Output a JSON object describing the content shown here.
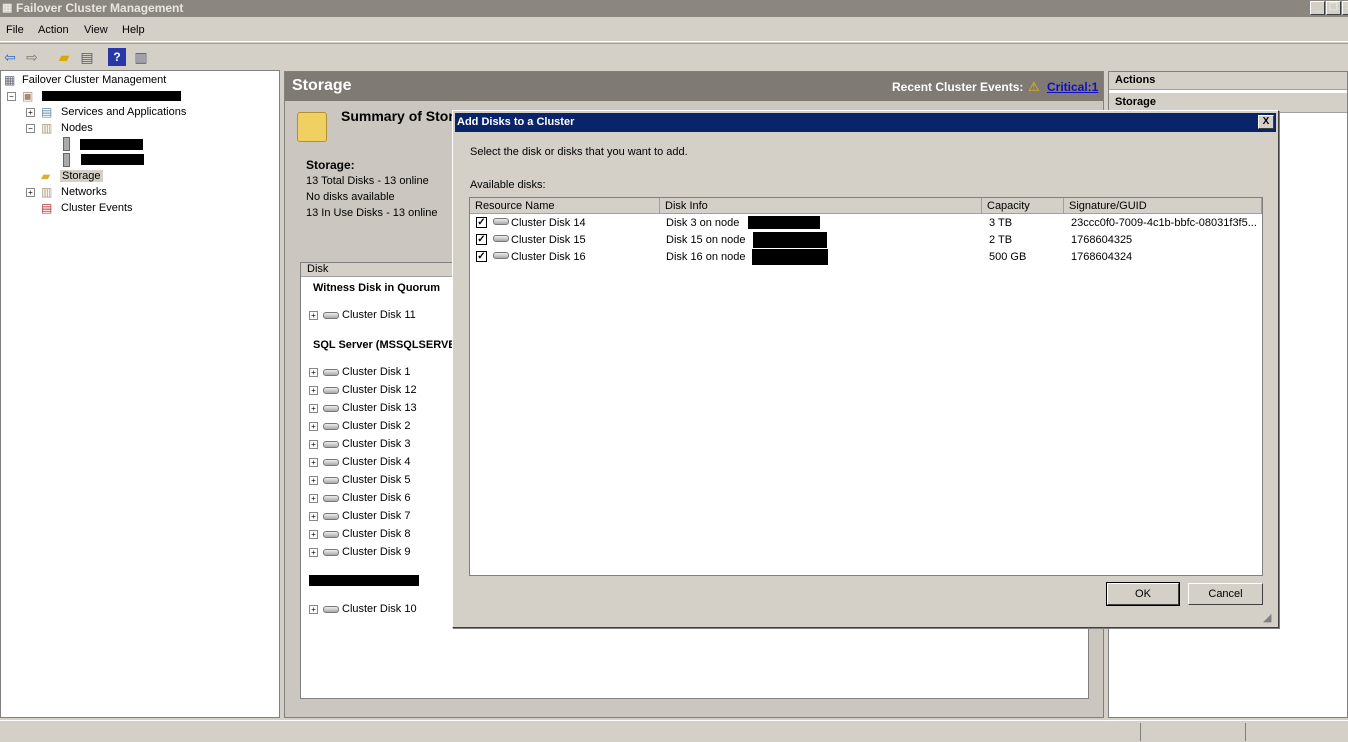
{
  "window": {
    "title": "Failover Cluster Management"
  },
  "menu": [
    "File",
    "Action",
    "View",
    "Help"
  ],
  "tree": {
    "root": "Failover Cluster Management",
    "items": [
      "Services and Applications",
      "Nodes",
      "Storage",
      "Networks",
      "Cluster Events"
    ]
  },
  "center": {
    "title": "Storage",
    "events_label": "Recent Cluster Events:",
    "events_link": "Critical:1",
    "summary_title": "Summary of Storage",
    "storage_heading": "Storage:",
    "stats": [
      "13 Total Disks - 13 online",
      "No disks available",
      "13 In Use Disks - 13 online"
    ],
    "list_header": "Disk",
    "group1": "Witness Disk in Quorum",
    "group1_disks": [
      "Cluster Disk 11"
    ],
    "group2": "SQL Server (MSSQLSERVER)",
    "group2_disks": [
      "Cluster Disk 1",
      "Cluster Disk 12",
      "Cluster Disk 13",
      "Cluster Disk 2",
      "Cluster Disk 3",
      "Cluster Disk 4",
      "Cluster Disk 5",
      "Cluster Disk 6",
      "Cluster Disk 7",
      "Cluster Disk 8",
      "Cluster Disk 9"
    ],
    "group3_disks": [
      "Cluster Disk 10"
    ]
  },
  "actions": {
    "title": "Actions",
    "section": "Storage"
  },
  "dialog": {
    "title": "Add Disks to a Cluster",
    "instruction": "Select the disk or disks that you want to add.",
    "available_label": "Available disks:",
    "columns": [
      "Resource Name",
      "Disk Info",
      "Capacity",
      "Signature/GUID"
    ],
    "rows": [
      {
        "name": "Cluster Disk 14",
        "info": "Disk 3 on node",
        "capacity": "3 TB",
        "signature": "23ccc0f0-7009-4c1b-bbfc-08031f3f5...",
        "checked": true
      },
      {
        "name": "Cluster Disk 15",
        "info": "Disk 15 on node",
        "capacity": "2 TB",
        "signature": "1768604325",
        "checked": true
      },
      {
        "name": "Cluster Disk 16",
        "info": "Disk 16 on node",
        "capacity": "500 GB",
        "signature": "1768604324",
        "checked": true
      }
    ],
    "ok": "OK",
    "cancel": "Cancel",
    "close": "X"
  }
}
